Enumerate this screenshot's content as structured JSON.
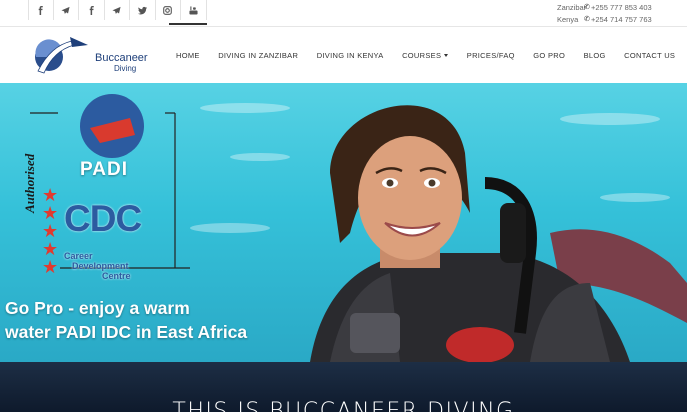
{
  "social_icons": [
    "facebook-icon",
    "airplane-icon",
    "facebook-icon",
    "airplane-icon",
    "twitter-icon",
    "instagram-icon",
    "youtube-icon"
  ],
  "contacts": [
    {
      "country": "Zanzibar",
      "phone": "+255 777 853 403"
    },
    {
      "country": "Kenya",
      "phone": "+254 714 757 763"
    }
  ],
  "logo": {
    "name": "Buccaneer",
    "sub": "Diving"
  },
  "nav": {
    "items": [
      {
        "label": "HOME",
        "active": true
      },
      {
        "label": "DIVING IN ZANZIBAR"
      },
      {
        "label": "DIVING IN KENYA"
      },
      {
        "label": "COURSES",
        "dropdown": true
      },
      {
        "label": "PRICES/FAQ"
      },
      {
        "label": "GO PRO"
      },
      {
        "label": "BLOG"
      },
      {
        "label": "CONTACT US"
      }
    ]
  },
  "hero": {
    "badge_authorised": "Authorised",
    "badge_padi": "PADI",
    "badge_idc": "CDC",
    "badge_cdc_lines": [
      "Career",
      "Development",
      "Centre"
    ],
    "headline_line1": "Go Pro - enjoy a warm",
    "headline_line2": "water PADI IDC in East Africa"
  },
  "section_title": "THIS IS BUCCANEER DIVING",
  "colors": {
    "accent": "#1e3f7a",
    "water": "#35c1d9",
    "star": "#e23a2f"
  }
}
